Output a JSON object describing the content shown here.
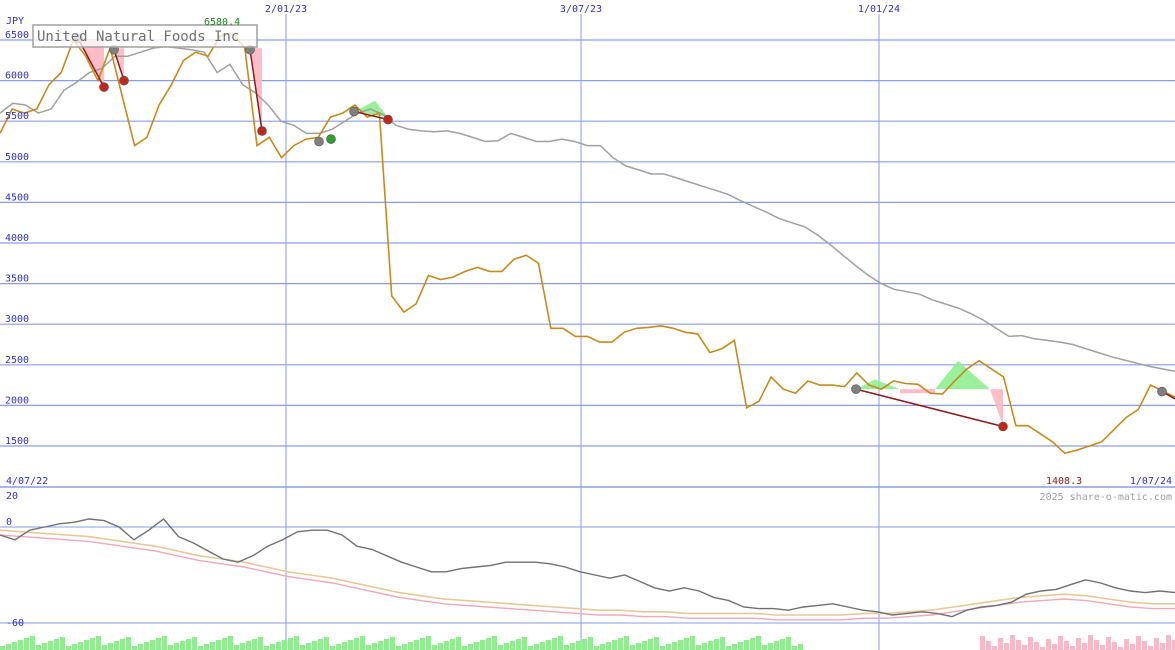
{
  "colors": {
    "grid": "#8a9de8",
    "axis_text": "#3030c8",
    "price": "#c88a1a",
    "ma": "#a0a0a0",
    "osc": "#707070",
    "osc_pink": "#f0a8b8",
    "osc_tan": "#e8c898",
    "vol_green": "#90ee90",
    "vol_pink": "#f8b8c8",
    "max_text": "#1a8a1a",
    "min_text": "#8a1a1a",
    "trade_line": "#8b1a1a",
    "fill_green": "#90ee90",
    "fill_pink": "#ffb6c1",
    "marker_red": "#c0281e",
    "marker_gray": "#808080",
    "marker_green": "#2e9e2e"
  },
  "chart_data": [
    {
      "type": "line",
      "title": "United Natural Foods Inc",
      "currency": "JPY",
      "watermark": "2025 share-o-matic.com",
      "ylim": [
        1100,
        6800
      ],
      "y_ticks": [
        6500,
        6000,
        5500,
        5000,
        4500,
        4000,
        3500,
        3000,
        2500,
        2000,
        1500
      ],
      "x_date_labels": [
        "2/01/23",
        "3/07/23",
        "1/01/24"
      ],
      "start_label": "4/07/22",
      "end_label": "1/07/24",
      "max_label": "6580.4",
      "min_label": "1408.3",
      "grid": true,
      "series": [
        {
          "values": [
            5350,
            5650,
            5600,
            5650,
            5950,
            6100,
            6500,
            6300,
            6000,
            6400,
            5800,
            5200,
            5300,
            5700,
            5950,
            6250,
            6350,
            6300,
            6550,
            6580,
            6400,
            5200,
            5300,
            5050,
            5200,
            5280,
            5300,
            5550,
            5600,
            5700,
            5550,
            5600,
            3350,
            3150,
            3250,
            3600,
            3550,
            3580,
            3650,
            3700,
            3650,
            3650,
            3800,
            3850,
            3750,
            2950,
            2950,
            2850,
            2850,
            2780,
            2780,
            2900,
            2950,
            2960,
            2980,
            2950,
            2900,
            2880,
            2650,
            2700,
            2800,
            1970,
            2050,
            2350,
            2200,
            2150,
            2300,
            2250,
            2250,
            2230,
            2400,
            2250,
            2200,
            2300,
            2270,
            2260,
            2150,
            2140,
            2300,
            2450,
            2550,
            2450,
            2350,
            1750,
            1750,
            1650,
            1550,
            1410,
            1450,
            1500,
            1550,
            1700,
            1850,
            1950,
            2250,
            2180,
            2100
          ]
        },
        {
          "values": [
            5600,
            5720,
            5700,
            5600,
            5650,
            5880,
            5980,
            6100,
            6150,
            6300,
            6300,
            6350,
            6400,
            6420,
            6400,
            6380,
            6350,
            6100,
            6200,
            5950,
            5850,
            5700,
            5500,
            5450,
            5350,
            5350,
            5400,
            5500,
            5600,
            5650,
            5580,
            5450,
            5400,
            5380,
            5370,
            5380,
            5350,
            5300,
            5250,
            5260,
            5350,
            5300,
            5250,
            5250,
            5280,
            5250,
            5200,
            5200,
            5050,
            4950,
            4900,
            4850,
            4850,
            4800,
            4750,
            4700,
            4650,
            4600,
            4520,
            4450,
            4380,
            4300,
            4250,
            4200,
            4100,
            3980,
            3850,
            3720,
            3600,
            3500,
            3430,
            3400,
            3370,
            3300,
            3250,
            3200,
            3130,
            3050,
            2950,
            2850,
            2860,
            2820,
            2800,
            2780,
            2750,
            2700,
            2650,
            2600,
            2560,
            2520,
            2480,
            2450,
            2420
          ]
        }
      ]
    },
    {
      "type": "line",
      "y_ticks": [
        20,
        0,
        -60
      ],
      "series": [
        {
          "values": [
            -5,
            -8,
            -2,
            0,
            2,
            3,
            5,
            4,
            0,
            -8,
            -2,
            5,
            -6,
            -10,
            -15,
            -20,
            -22,
            -18,
            -12,
            -8,
            -3,
            -2,
            -2,
            -5,
            -12,
            -14,
            -18,
            -22,
            -25,
            -28,
            -28,
            -26,
            -25,
            -24,
            -22,
            -22,
            -22,
            -23,
            -25,
            -28,
            -30,
            -32,
            -30,
            -34,
            -38,
            -40,
            -38,
            -40,
            -44,
            -46,
            -50,
            -51,
            -51,
            -52,
            -50,
            -49,
            -48,
            -50,
            -52,
            -53,
            -55,
            -54,
            -53,
            -54,
            -56,
            -52,
            -50,
            -49,
            -47,
            -42,
            -40,
            -39,
            -36,
            -33,
            -35,
            -38,
            -40,
            -41,
            -40,
            -41
          ]
        },
        {
          "values": [
            -2,
            -3,
            -4,
            -5,
            -6,
            -8,
            -10,
            -12,
            -15,
            -18,
            -20,
            -22,
            -25,
            -28,
            -30,
            -32,
            -35,
            -38,
            -41,
            -43,
            -45,
            -46,
            -47,
            -48,
            -49,
            -50,
            -51,
            -52,
            -52,
            -53,
            -53,
            -54,
            -54,
            -54,
            -54,
            -55,
            -55,
            -55,
            -55,
            -54,
            -54,
            -53,
            -52,
            -50,
            -48,
            -46,
            -44,
            -43,
            -42,
            -43,
            -45,
            -47,
            -48,
            -48
          ]
        }
      ]
    }
  ]
}
